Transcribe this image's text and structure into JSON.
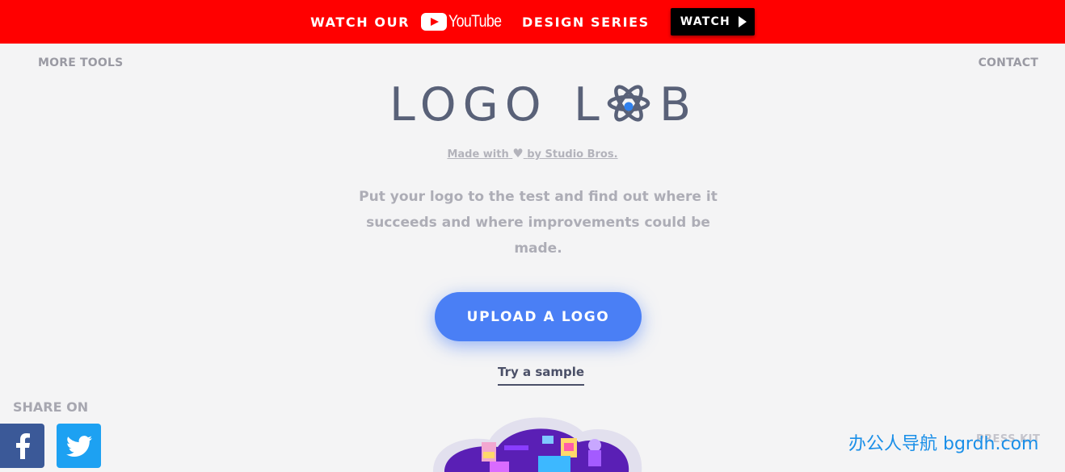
{
  "banner": {
    "text_left": "WATCH OUR",
    "brand_icon": "youtube-icon",
    "brand_word": "YouTube",
    "text_right": "DESIGN SERIES",
    "watch_label": "WATCH",
    "bg_color": "#ff0000"
  },
  "nav": {
    "left_link": "MORE TOOLS",
    "right_link": "CONTACT"
  },
  "logo": {
    "part1": "LOGO",
    "part2_L": "L",
    "part2_B": "B",
    "atom_icon": "atom-icon",
    "dot_color": "#2f80ed"
  },
  "credit": {
    "prefix": "Made with",
    "heart_icon": "heart-icon",
    "suffix": "by Studio Bros."
  },
  "tagline": "Put your logo to the test and find out where it succeeds and where improvements could be made.",
  "upload_button": "UPLOAD A LOGO",
  "sample_link": "Try a sample",
  "share": {
    "label": "SHARE ON",
    "facebook_icon": "facebook-icon",
    "twitter_icon": "twitter-icon"
  },
  "press_kit": "PRESS KIT",
  "watermark": "办公人导航 bgrdh.com",
  "colors": {
    "accent": "#4a7ff5",
    "facebook": "#3b5998",
    "twitter": "#1da1f2"
  }
}
